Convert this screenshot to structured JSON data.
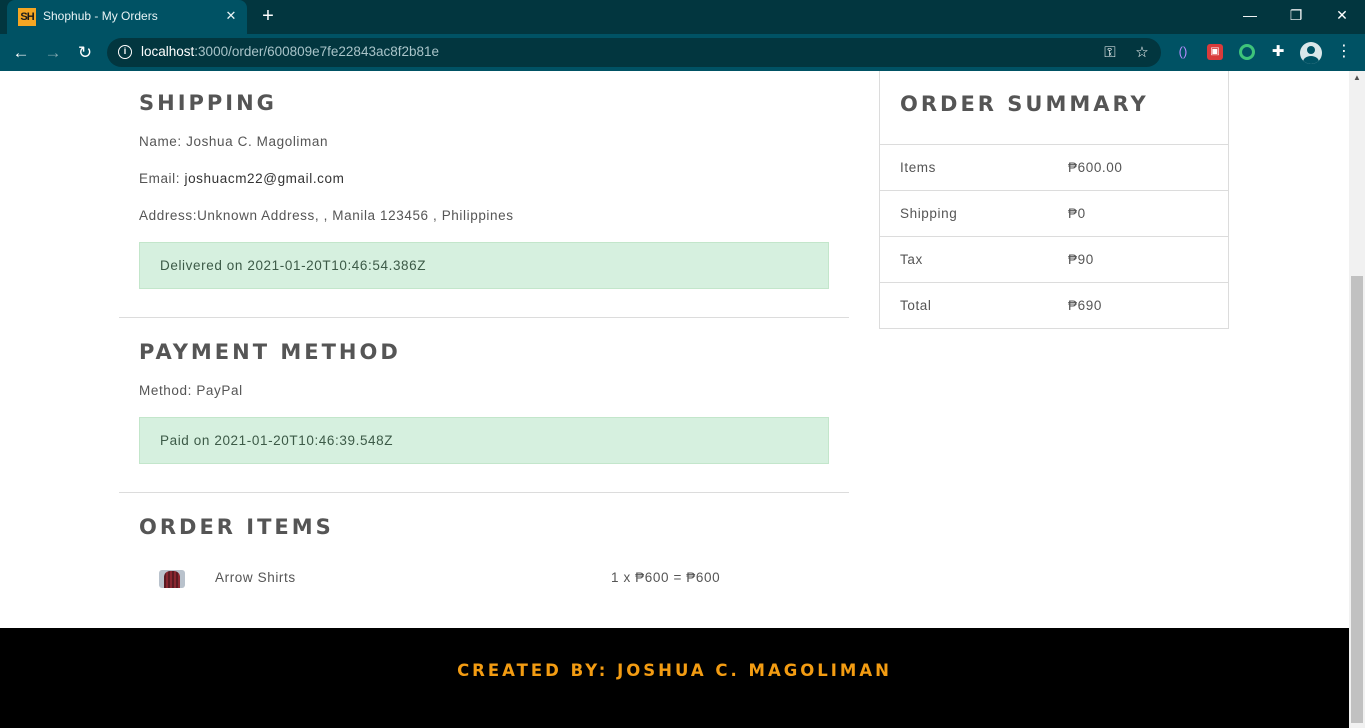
{
  "browser": {
    "tab_title": "Shophub - My Orders",
    "favicon_text": "SH",
    "tab_close_icon": "✕",
    "new_tab_icon": "+",
    "url_host": "localhost",
    "url_path": ":3000/order/600809e7fe22843ac8f2b81e",
    "window_controls": {
      "minimize": "—",
      "restore": "❐",
      "close": "✕"
    },
    "nav": {
      "back": "←",
      "forward": "→",
      "reload": "↻"
    },
    "icons": {
      "key": "⚿",
      "star": "☆",
      "ext_1": "()",
      "ext_2": "▣",
      "ext_4": "✚",
      "menu": "⋮",
      "info": "i"
    }
  },
  "shipping": {
    "heading": "SHIPPING",
    "name": "Name: Joshua C. Magoliman",
    "email_label": "Email: ",
    "email": "joshuacm22@gmail.com",
    "address": "Address:Unknown Address, , Manila 123456 , Philippines",
    "status": "Delivered on 2021-01-20T10:46:54.386Z"
  },
  "payment": {
    "heading": "PAYMENT METHOD",
    "method": "Method: PayPal",
    "status": "Paid on 2021-01-20T10:46:39.548Z"
  },
  "order_items": {
    "heading": "ORDER ITEMS",
    "items": [
      {
        "name": "Arrow Shirts",
        "calc": "1 x ₱600 = ₱600"
      }
    ]
  },
  "summary": {
    "heading": "ORDER SUMMARY",
    "rows": [
      {
        "label": "Items",
        "value": "₱600.00"
      },
      {
        "label": "Shipping",
        "value": "₱0"
      },
      {
        "label": "Tax",
        "value": "₱90"
      },
      {
        "label": "Total",
        "value": "₱690"
      }
    ]
  },
  "footer": {
    "text": "CREATED BY: JOSHUA C. MAGOLIMAN"
  },
  "colors": {
    "footer_accent": "#f39c12",
    "alert_bg": "#d6f0df",
    "chrome": "#005264"
  }
}
